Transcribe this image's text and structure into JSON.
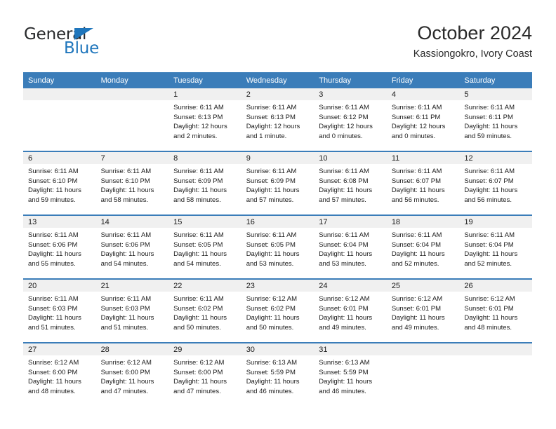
{
  "brand": {
    "name_part1": "General",
    "name_part2": "Blue",
    "accent_color": "#1f76bc"
  },
  "header": {
    "title": "October 2024",
    "subtitle": "Kassiongokro, Ivory Coast"
  },
  "theme": {
    "header_blue": "#3b7db9",
    "band_gray": "#f0f0f0"
  },
  "weekdays": [
    "Sunday",
    "Monday",
    "Tuesday",
    "Wednesday",
    "Thursday",
    "Friday",
    "Saturday"
  ],
  "weeks": [
    [
      {
        "day": "",
        "sunrise": "",
        "sunset": "",
        "daylight1": "",
        "daylight2": ""
      },
      {
        "day": "",
        "sunrise": "",
        "sunset": "",
        "daylight1": "",
        "daylight2": ""
      },
      {
        "day": "1",
        "sunrise": "Sunrise: 6:11 AM",
        "sunset": "Sunset: 6:13 PM",
        "daylight1": "Daylight: 12 hours",
        "daylight2": "and 2 minutes."
      },
      {
        "day": "2",
        "sunrise": "Sunrise: 6:11 AM",
        "sunset": "Sunset: 6:13 PM",
        "daylight1": "Daylight: 12 hours",
        "daylight2": "and 1 minute."
      },
      {
        "day": "3",
        "sunrise": "Sunrise: 6:11 AM",
        "sunset": "Sunset: 6:12 PM",
        "daylight1": "Daylight: 12 hours",
        "daylight2": "and 0 minutes."
      },
      {
        "day": "4",
        "sunrise": "Sunrise: 6:11 AM",
        "sunset": "Sunset: 6:11 PM",
        "daylight1": "Daylight: 12 hours",
        "daylight2": "and 0 minutes."
      },
      {
        "day": "5",
        "sunrise": "Sunrise: 6:11 AM",
        "sunset": "Sunset: 6:11 PM",
        "daylight1": "Daylight: 11 hours",
        "daylight2": "and 59 minutes."
      }
    ],
    [
      {
        "day": "6",
        "sunrise": "Sunrise: 6:11 AM",
        "sunset": "Sunset: 6:10 PM",
        "daylight1": "Daylight: 11 hours",
        "daylight2": "and 59 minutes."
      },
      {
        "day": "7",
        "sunrise": "Sunrise: 6:11 AM",
        "sunset": "Sunset: 6:10 PM",
        "daylight1": "Daylight: 11 hours",
        "daylight2": "and 58 minutes."
      },
      {
        "day": "8",
        "sunrise": "Sunrise: 6:11 AM",
        "sunset": "Sunset: 6:09 PM",
        "daylight1": "Daylight: 11 hours",
        "daylight2": "and 58 minutes."
      },
      {
        "day": "9",
        "sunrise": "Sunrise: 6:11 AM",
        "sunset": "Sunset: 6:09 PM",
        "daylight1": "Daylight: 11 hours",
        "daylight2": "and 57 minutes."
      },
      {
        "day": "10",
        "sunrise": "Sunrise: 6:11 AM",
        "sunset": "Sunset: 6:08 PM",
        "daylight1": "Daylight: 11 hours",
        "daylight2": "and 57 minutes."
      },
      {
        "day": "11",
        "sunrise": "Sunrise: 6:11 AM",
        "sunset": "Sunset: 6:07 PM",
        "daylight1": "Daylight: 11 hours",
        "daylight2": "and 56 minutes."
      },
      {
        "day": "12",
        "sunrise": "Sunrise: 6:11 AM",
        "sunset": "Sunset: 6:07 PM",
        "daylight1": "Daylight: 11 hours",
        "daylight2": "and 56 minutes."
      }
    ],
    [
      {
        "day": "13",
        "sunrise": "Sunrise: 6:11 AM",
        "sunset": "Sunset: 6:06 PM",
        "daylight1": "Daylight: 11 hours",
        "daylight2": "and 55 minutes."
      },
      {
        "day": "14",
        "sunrise": "Sunrise: 6:11 AM",
        "sunset": "Sunset: 6:06 PM",
        "daylight1": "Daylight: 11 hours",
        "daylight2": "and 54 minutes."
      },
      {
        "day": "15",
        "sunrise": "Sunrise: 6:11 AM",
        "sunset": "Sunset: 6:05 PM",
        "daylight1": "Daylight: 11 hours",
        "daylight2": "and 54 minutes."
      },
      {
        "day": "16",
        "sunrise": "Sunrise: 6:11 AM",
        "sunset": "Sunset: 6:05 PM",
        "daylight1": "Daylight: 11 hours",
        "daylight2": "and 53 minutes."
      },
      {
        "day": "17",
        "sunrise": "Sunrise: 6:11 AM",
        "sunset": "Sunset: 6:04 PM",
        "daylight1": "Daylight: 11 hours",
        "daylight2": "and 53 minutes."
      },
      {
        "day": "18",
        "sunrise": "Sunrise: 6:11 AM",
        "sunset": "Sunset: 6:04 PM",
        "daylight1": "Daylight: 11 hours",
        "daylight2": "and 52 minutes."
      },
      {
        "day": "19",
        "sunrise": "Sunrise: 6:11 AM",
        "sunset": "Sunset: 6:04 PM",
        "daylight1": "Daylight: 11 hours",
        "daylight2": "and 52 minutes."
      }
    ],
    [
      {
        "day": "20",
        "sunrise": "Sunrise: 6:11 AM",
        "sunset": "Sunset: 6:03 PM",
        "daylight1": "Daylight: 11 hours",
        "daylight2": "and 51 minutes."
      },
      {
        "day": "21",
        "sunrise": "Sunrise: 6:11 AM",
        "sunset": "Sunset: 6:03 PM",
        "daylight1": "Daylight: 11 hours",
        "daylight2": "and 51 minutes."
      },
      {
        "day": "22",
        "sunrise": "Sunrise: 6:11 AM",
        "sunset": "Sunset: 6:02 PM",
        "daylight1": "Daylight: 11 hours",
        "daylight2": "and 50 minutes."
      },
      {
        "day": "23",
        "sunrise": "Sunrise: 6:12 AM",
        "sunset": "Sunset: 6:02 PM",
        "daylight1": "Daylight: 11 hours",
        "daylight2": "and 50 minutes."
      },
      {
        "day": "24",
        "sunrise": "Sunrise: 6:12 AM",
        "sunset": "Sunset: 6:01 PM",
        "daylight1": "Daylight: 11 hours",
        "daylight2": "and 49 minutes."
      },
      {
        "day": "25",
        "sunrise": "Sunrise: 6:12 AM",
        "sunset": "Sunset: 6:01 PM",
        "daylight1": "Daylight: 11 hours",
        "daylight2": "and 49 minutes."
      },
      {
        "day": "26",
        "sunrise": "Sunrise: 6:12 AM",
        "sunset": "Sunset: 6:01 PM",
        "daylight1": "Daylight: 11 hours",
        "daylight2": "and 48 minutes."
      }
    ],
    [
      {
        "day": "27",
        "sunrise": "Sunrise: 6:12 AM",
        "sunset": "Sunset: 6:00 PM",
        "daylight1": "Daylight: 11 hours",
        "daylight2": "and 48 minutes."
      },
      {
        "day": "28",
        "sunrise": "Sunrise: 6:12 AM",
        "sunset": "Sunset: 6:00 PM",
        "daylight1": "Daylight: 11 hours",
        "daylight2": "and 47 minutes."
      },
      {
        "day": "29",
        "sunrise": "Sunrise: 6:12 AM",
        "sunset": "Sunset: 6:00 PM",
        "daylight1": "Daylight: 11 hours",
        "daylight2": "and 47 minutes."
      },
      {
        "day": "30",
        "sunrise": "Sunrise: 6:13 AM",
        "sunset": "Sunset: 5:59 PM",
        "daylight1": "Daylight: 11 hours",
        "daylight2": "and 46 minutes."
      },
      {
        "day": "31",
        "sunrise": "Sunrise: 6:13 AM",
        "sunset": "Sunset: 5:59 PM",
        "daylight1": "Daylight: 11 hours",
        "daylight2": "and 46 minutes."
      },
      {
        "day": "",
        "sunrise": "",
        "sunset": "",
        "daylight1": "",
        "daylight2": ""
      },
      {
        "day": "",
        "sunrise": "",
        "sunset": "",
        "daylight1": "",
        "daylight2": ""
      }
    ]
  ]
}
